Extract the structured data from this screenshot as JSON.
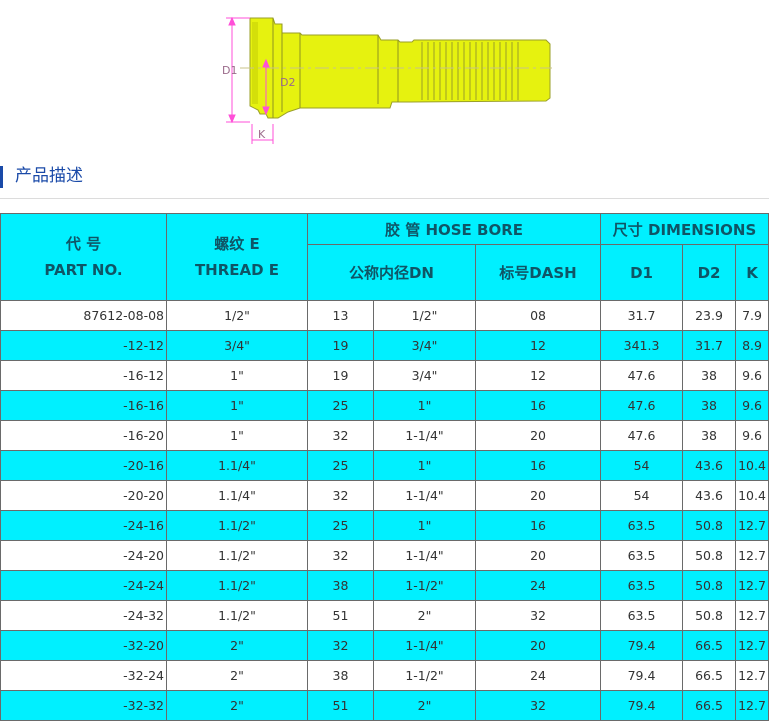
{
  "figure": {
    "labels": {
      "d1": "D1",
      "d2": "D2",
      "k": "K"
    },
    "colors": {
      "body": "#e6f20f",
      "outline": "#9a9f2a",
      "dimension": "#ff4fd8"
    }
  },
  "section": {
    "title": "产品描述"
  },
  "table": {
    "headers": {
      "part_cn": "代 号",
      "part_en": "PART NO.",
      "thread_cn": "螺纹 E",
      "thread_en": "THREAD E",
      "hose_bore": "胶 管 HOSE BORE",
      "dimensions": "尺寸 DIMENSIONS",
      "nominal_dn": "公称内径DN",
      "dash": "标号DASH",
      "d1": "D1",
      "d2": "D2",
      "k": "K"
    },
    "rows": [
      {
        "part": "87612-08-08",
        "thread": "1/2\"",
        "dn_mm": "13",
        "dn_in": "1/2\"",
        "dash": "08",
        "d1": "31.7",
        "d2": "23.9",
        "k": "7.9"
      },
      {
        "part": "-12-12",
        "thread": "3/4\"",
        "dn_mm": "19",
        "dn_in": "3/4\"",
        "dash": "12",
        "d1": "341.3",
        "d2": "31.7",
        "k": "8.9"
      },
      {
        "part": "-16-12",
        "thread": "1\"",
        "dn_mm": "19",
        "dn_in": "3/4\"",
        "dash": "12",
        "d1": "47.6",
        "d2": "38",
        "k": "9.6"
      },
      {
        "part": "-16-16",
        "thread": "1\"",
        "dn_mm": "25",
        "dn_in": "1\"",
        "dash": "16",
        "d1": "47.6",
        "d2": "38",
        "k": "9.6"
      },
      {
        "part": "-16-20",
        "thread": "1\"",
        "dn_mm": "32",
        "dn_in": "1-1/4\"",
        "dash": "20",
        "d1": "47.6",
        "d2": "38",
        "k": "9.6"
      },
      {
        "part": "-20-16",
        "thread": "1.1/4\"",
        "dn_mm": "25",
        "dn_in": "1\"",
        "dash": "16",
        "d1": "54",
        "d2": "43.6",
        "k": "10.4"
      },
      {
        "part": "-20-20",
        "thread": "1.1/4\"",
        "dn_mm": "32",
        "dn_in": "1-1/4\"",
        "dash": "20",
        "d1": "54",
        "d2": "43.6",
        "k": "10.4"
      },
      {
        "part": "-24-16",
        "thread": "1.1/2\"",
        "dn_mm": "25",
        "dn_in": "1\"",
        "dash": "16",
        "d1": "63.5",
        "d2": "50.8",
        "k": "12.7"
      },
      {
        "part": "-24-20",
        "thread": "1.1/2\"",
        "dn_mm": "32",
        "dn_in": "1-1/4\"",
        "dash": "20",
        "d1": "63.5",
        "d2": "50.8",
        "k": "12.7"
      },
      {
        "part": "-24-24",
        "thread": "1.1/2\"",
        "dn_mm": "38",
        "dn_in": "1-1/2\"",
        "dash": "24",
        "d1": "63.5",
        "d2": "50.8",
        "k": "12.7"
      },
      {
        "part": "-24-32",
        "thread": "1.1/2\"",
        "dn_mm": "51",
        "dn_in": "2\"",
        "dash": "32",
        "d1": "63.5",
        "d2": "50.8",
        "k": "12.7"
      },
      {
        "part": "-32-20",
        "thread": "2\"",
        "dn_mm": "32",
        "dn_in": "1-1/4\"",
        "dash": "20",
        "d1": "79.4",
        "d2": "66.5",
        "k": "12.7"
      },
      {
        "part": "-32-24",
        "thread": "2\"",
        "dn_mm": "38",
        "dn_in": "1-1/2\"",
        "dash": "24",
        "d1": "79.4",
        "d2": "66.5",
        "k": "12.7"
      },
      {
        "part": "-32-32",
        "thread": "2\"",
        "dn_mm": "51",
        "dn_in": "2\"",
        "dash": "32",
        "d1": "79.4",
        "d2": "66.5",
        "k": "12.7"
      }
    ]
  },
  "colors": {
    "header_bg": "#00f0ff",
    "header_text": "#0f5566",
    "row_alt_bg": "#00f0ff",
    "row_bg": "#ffffff",
    "accent": "#1a4aa8",
    "border": "#6a6a6a"
  }
}
